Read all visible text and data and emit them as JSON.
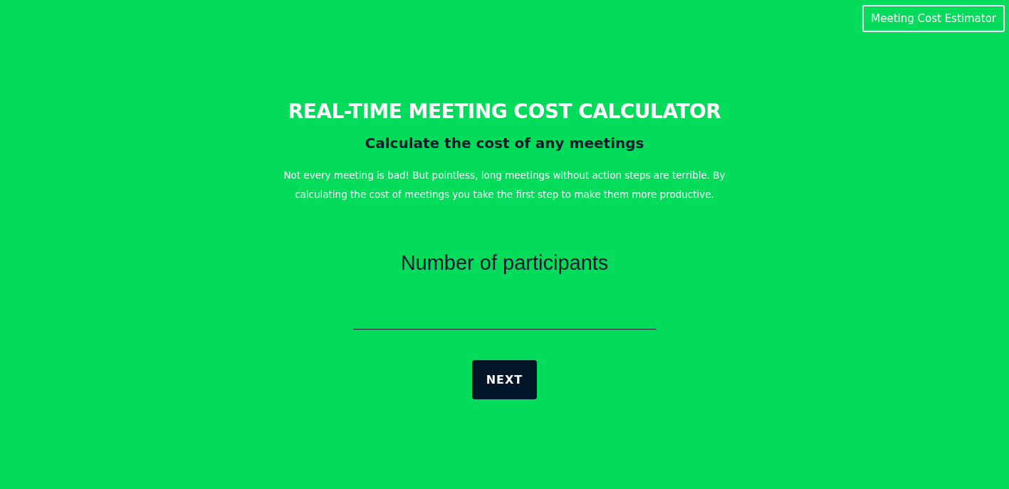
{
  "header_link": "Meeting Cost Estimator",
  "title": "REAL-TIME MEETING COST CALCULATOR",
  "subtitle": "Calculate the cost of any meetings",
  "intro": "Not every meeting is bad! But pointless, long meetings without action steps are terrible. By calculating the cost of meetings you take the first step to make them more productive.",
  "question": {
    "label": "Number of participants"
  },
  "next_button": "NEXT"
}
